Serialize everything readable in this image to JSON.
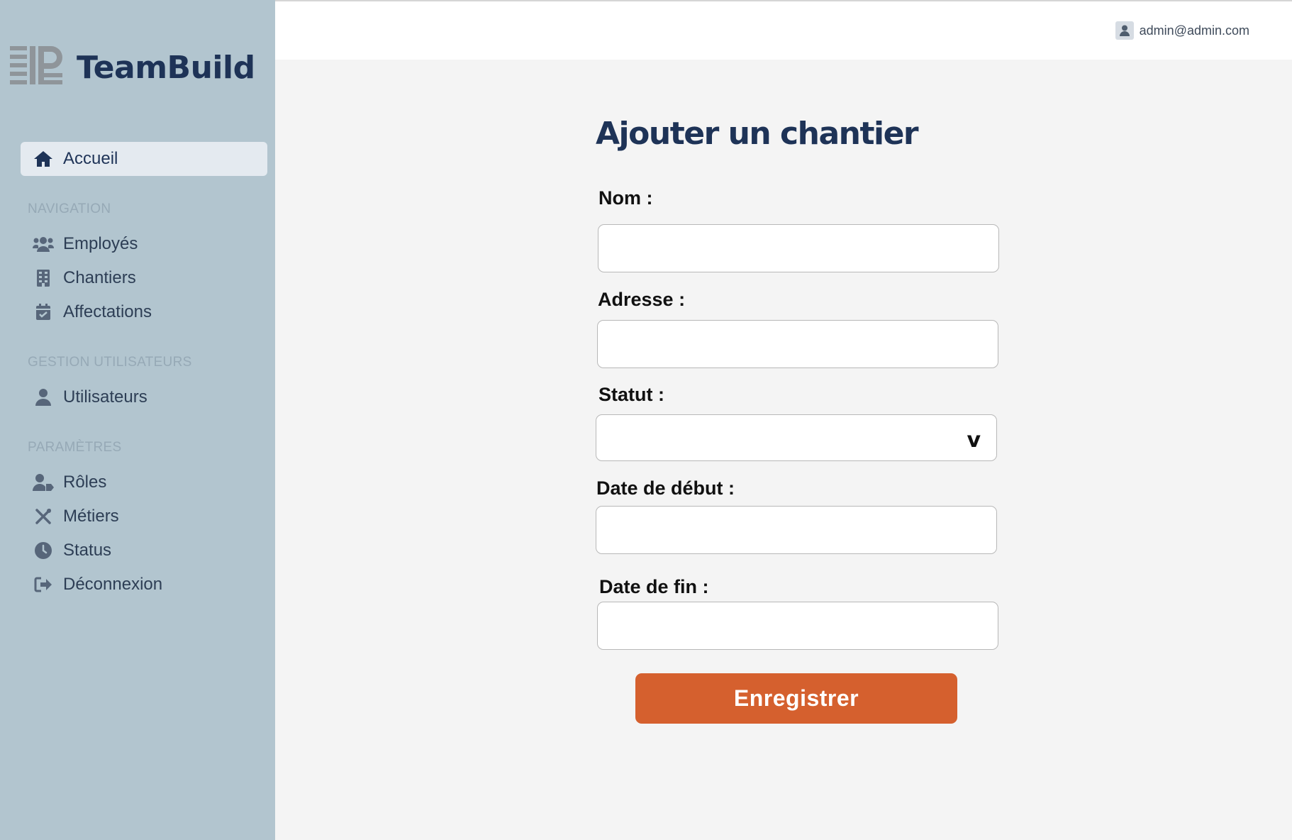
{
  "brand": {
    "name": "TeamBuild",
    "logo": "tb-logo-icon"
  },
  "header": {
    "user_email": "admin@admin.com",
    "user_icon": "user-icon"
  },
  "sidebar": {
    "home": {
      "label": "Accueil",
      "icon": "home-icon"
    },
    "sections": [
      {
        "title": "NAVIGATION",
        "items": [
          {
            "label": "Employés",
            "icon": "users-icon"
          },
          {
            "label": "Chantiers",
            "icon": "building-icon"
          },
          {
            "label": "Affectations",
            "icon": "calendar-check-icon"
          }
        ]
      },
      {
        "title": "GESTION UTILISATEURS",
        "items": [
          {
            "label": "Utilisateurs",
            "icon": "user-icon"
          }
        ]
      },
      {
        "title": "PARAMÈTRES",
        "items": [
          {
            "label": "Rôles",
            "icon": "user-tag-icon"
          },
          {
            "label": "Métiers",
            "icon": "tools-icon"
          },
          {
            "label": "Status",
            "icon": "clock-icon"
          },
          {
            "label": "Déconnexion",
            "icon": "logout-icon"
          }
        ]
      }
    ]
  },
  "form": {
    "title": "Ajouter un chantier",
    "fields": {
      "nom": {
        "label": "Nom  :",
        "value": ""
      },
      "adresse": {
        "label": "Adresse  :",
        "value": ""
      },
      "statut": {
        "label": "Statut :",
        "value": "",
        "chevron": "v"
      },
      "date_debut": {
        "label": "Date de début :",
        "value": ""
      },
      "date_fin": {
        "label": "Date de fin :",
        "value": ""
      }
    },
    "submit_label": "Enregistrer"
  },
  "colors": {
    "sidebar_bg": "#b2c5cf",
    "brand_text": "#1e3357",
    "accent_button": "#d5602e",
    "active_item_bg": "#e4eaf0",
    "page_bg": "#f4f4f4"
  }
}
